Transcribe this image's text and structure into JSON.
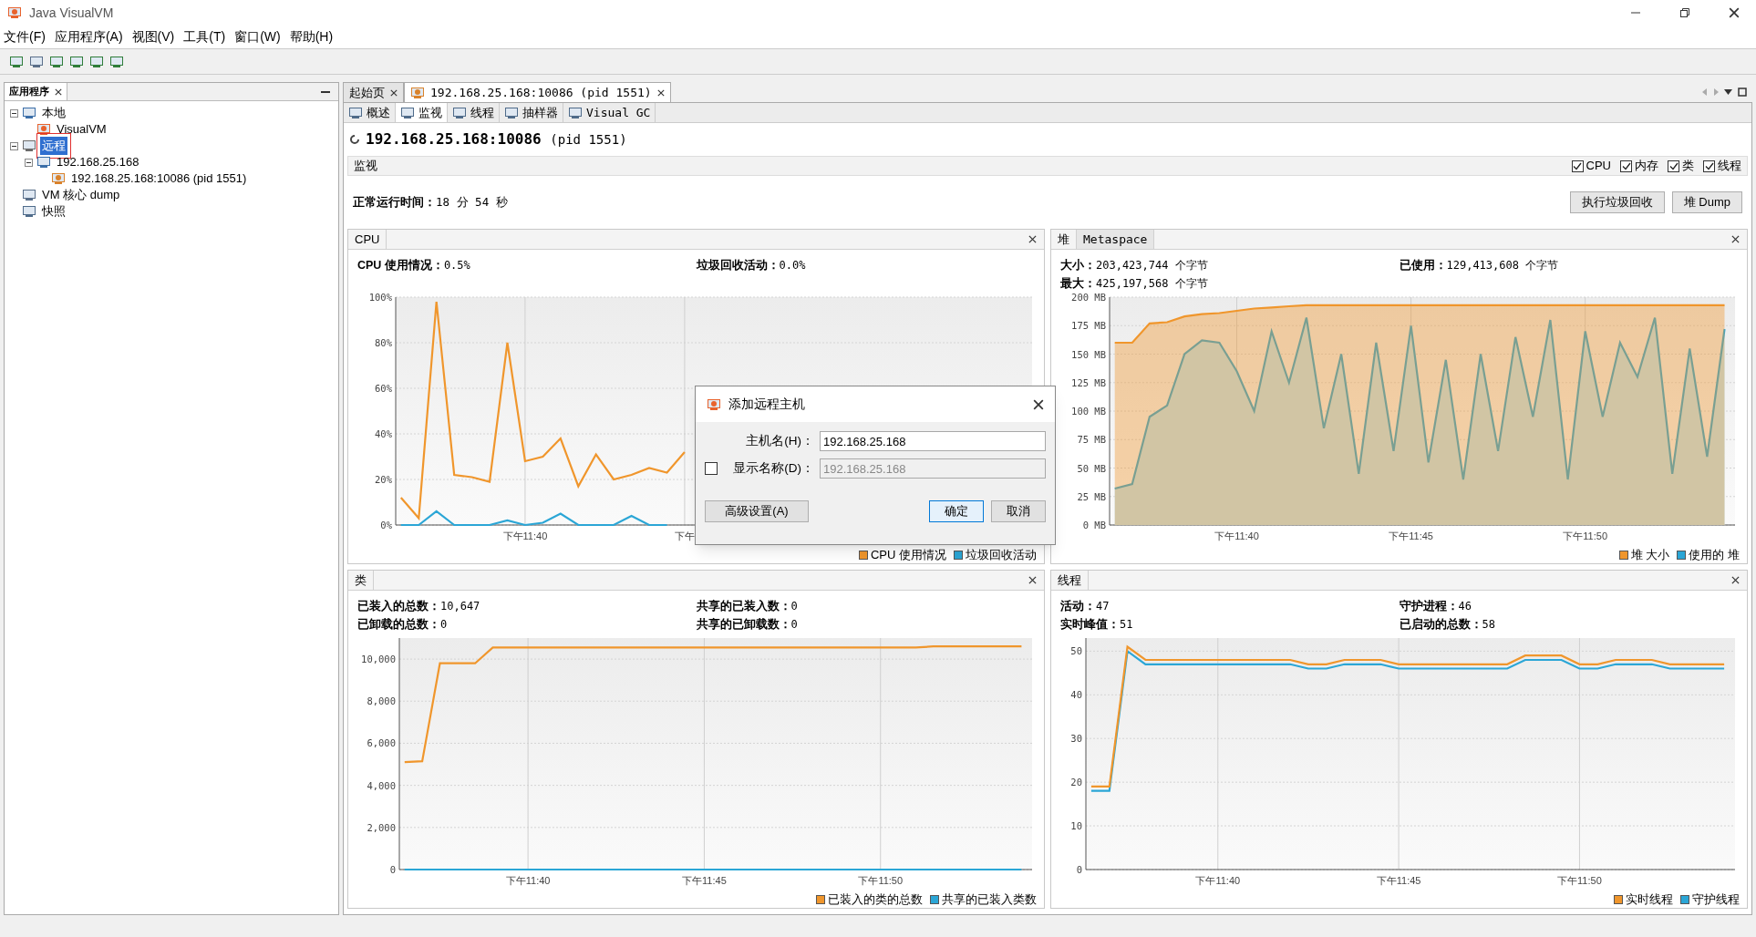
{
  "window": {
    "title": "Java VisualVM"
  },
  "menu": [
    "文件(F)",
    "应用程序(A)",
    "视图(V)",
    "工具(T)",
    "窗口(W)",
    "帮助(H)"
  ],
  "app_panel": {
    "tab": "应用程序",
    "tree": [
      {
        "label": "本地",
        "kind": "computer",
        "expanded": true,
        "selected": false,
        "children": [
          {
            "label": "VisualVM",
            "kind": "app",
            "selected": false
          }
        ]
      },
      {
        "label": "远程",
        "kind": "network",
        "expanded": true,
        "selected": true,
        "children": [
          {
            "label": "192.168.25.168",
            "kind": "host",
            "expanded": true,
            "selected": false,
            "children": [
              {
                "label": "192.168.25.168:10086 (pid 1551)",
                "kind": "jmx",
                "selected": false
              }
            ]
          }
        ]
      },
      {
        "label": "VM 核心 dump",
        "kind": "dump",
        "selected": false
      },
      {
        "label": "快照",
        "kind": "snapshot",
        "selected": false
      }
    ]
  },
  "doc_tabs": [
    {
      "label": "起始页",
      "selected": false
    },
    {
      "label": "192.168.25.168:10086 (pid 1551)",
      "selected": true
    }
  ],
  "sub_tabs": [
    {
      "label": "概述",
      "selected": false
    },
    {
      "label": "监视",
      "selected": true
    },
    {
      "label": "线程",
      "selected": false
    },
    {
      "label": "抽样器",
      "selected": false
    },
    {
      "label": "Visual GC",
      "selected": false
    }
  ],
  "page_title": {
    "host": "192.168.25.168:10086",
    "pid": "(pid 1551)"
  },
  "monitor_bar": {
    "label": "监视",
    "toggles": [
      {
        "label": "CPU",
        "checked": true
      },
      {
        "label": "内存",
        "checked": true
      },
      {
        "label": "类",
        "checked": true
      },
      {
        "label": "线程",
        "checked": true
      }
    ]
  },
  "uptime": {
    "label": "正常运行时间：",
    "value": "18 分 54 秒"
  },
  "buttons": [
    "执行垃圾回收",
    "堆 Dump"
  ],
  "panels": [
    {
      "kind": "cpu",
      "tabs": [
        {
          "label": "CPU",
          "selected": true
        }
      ],
      "stats": [
        {
          "label": "CPU 使用情况：",
          "value": "0.5%"
        },
        {
          "label": "垃圾回收活动：",
          "value": "0.0%"
        }
      ],
      "chart_data": {
        "type": "line",
        "categories": [
          null,
          null,
          null,
          null,
          null,
          null,
          null,
          "下午11:40",
          null,
          null,
          null,
          null,
          null,
          null,
          null,
          null,
          "下午",
          null,
          null,
          null,
          null,
          null,
          null,
          null,
          null,
          null,
          null,
          null,
          null,
          null,
          null,
          null,
          null,
          null,
          null,
          null
        ],
        "ylim": [
          0,
          100
        ],
        "yticks": [
          {
            "value": 0,
            "label": "0%"
          },
          {
            "value": 20,
            "label": "20%"
          },
          {
            "value": 40,
            "label": "40%"
          },
          {
            "value": 60,
            "label": "60%"
          },
          {
            "value": 80,
            "label": "80%"
          },
          {
            "value": 100,
            "label": "100%"
          }
        ],
        "series": [
          {
            "name": "CPU 使用情况",
            "color": "#f0962c",
            "values": [
              12,
              3,
              98,
              22,
              21,
              19,
              80,
              28,
              30,
              38,
              17,
              31,
              20,
              22,
              25,
              23,
              32,
              null,
              null,
              null,
              null,
              null,
              null,
              null,
              null,
              null,
              null,
              null,
              null,
              null,
              null,
              null,
              null,
              null,
              null,
              null
            ]
          },
          {
            "name": "垃圾回收活动",
            "color": "#2ba6d6",
            "values": [
              0,
              0,
              6,
              0,
              0,
              0,
              2,
              0,
              1,
              5,
              0,
              0,
              0,
              4,
              0,
              0,
              null,
              null,
              null,
              null,
              null,
              null,
              null,
              null,
              null,
              null,
              null,
              null,
              null,
              null,
              null,
              null,
              null,
              null,
              null,
              null
            ]
          }
        ],
        "grid": true,
        "legend": true
      }
    },
    {
      "kind": "heap",
      "tabs": [
        {
          "label": "堆",
          "selected": true
        },
        {
          "label": "Metaspace",
          "selected": false
        }
      ],
      "stats": [
        {
          "label": "大小：",
          "value": "203,423,744 个字节"
        },
        {
          "label": "已使用：",
          "value": "129,413,608 个字节"
        },
        {
          "label": "最大：",
          "value": "425,197,568 个字节"
        }
      ],
      "chart_data": {
        "type": "area",
        "categories": [
          null,
          null,
          null,
          null,
          null,
          null,
          null,
          "下午11:40",
          null,
          null,
          null,
          null,
          null,
          null,
          null,
          null,
          null,
          "下午11:45",
          null,
          null,
          null,
          null,
          null,
          null,
          null,
          null,
          null,
          "下午11:50",
          null,
          null,
          null,
          null,
          null,
          null,
          null,
          null
        ],
        "ylim": [
          0,
          200
        ],
        "yticks": [
          {
            "value": 0,
            "label": "0 MB"
          },
          {
            "value": 25,
            "label": "25 MB"
          },
          {
            "value": 50,
            "label": "50 MB"
          },
          {
            "value": 75,
            "label": "75 MB"
          },
          {
            "value": 100,
            "label": "100 MB"
          },
          {
            "value": 125,
            "label": "125 MB"
          },
          {
            "value": 150,
            "label": "150 MB"
          },
          {
            "value": 175,
            "label": "175 MB"
          },
          {
            "value": 200,
            "label": "200 MB"
          }
        ],
        "series": [
          {
            "name": "堆 大小",
            "color": "#f0962c",
            "values": [
              160,
              160,
              177,
              178,
              183,
              185,
              186,
              188,
              190,
              191,
              192,
              193,
              193,
              193,
              193,
              193,
              193,
              193,
              193,
              193,
              193,
              193,
              193,
              193,
              193,
              193,
              193,
              193,
              193,
              193,
              193,
              193,
              193,
              193,
              193,
              193
            ]
          },
          {
            "name": "使用的 堆",
            "color": "#2ba6d6",
            "values": [
              32,
              36,
              95,
              105,
              150,
              162,
              160,
              135,
              100,
              170,
              125,
              182,
              85,
              150,
              45,
              160,
              65,
              175,
              55,
              145,
              40,
              150,
              65,
              165,
              95,
              180,
              40,
              170,
              95,
              160,
              130,
              182,
              45,
              155,
              60,
              172
            ]
          }
        ],
        "grid": true,
        "legend": true
      }
    },
    {
      "kind": "classes",
      "tabs": [
        {
          "label": "类",
          "selected": true
        }
      ],
      "stats": [
        {
          "label": "已装入的总数：",
          "value": "10,647"
        },
        {
          "label": "共享的已装入数：",
          "value": "0"
        },
        {
          "label": "已卸载的总数：",
          "value": "0"
        },
        {
          "label": "共享的已卸载数：",
          "value": "0"
        }
      ],
      "chart_data": {
        "type": "line",
        "categories": [
          null,
          null,
          null,
          null,
          null,
          null,
          null,
          "下午11:40",
          null,
          null,
          null,
          null,
          null,
          null,
          null,
          null,
          null,
          "下午11:45",
          null,
          null,
          null,
          null,
          null,
          null,
          null,
          null,
          null,
          "下午11:50",
          null,
          null,
          null,
          null,
          null,
          null,
          null,
          null
        ],
        "ylim": [
          0,
          11000
        ],
        "yticks": [
          {
            "value": 0,
            "label": "0"
          },
          {
            "value": 2000,
            "label": "2,000"
          },
          {
            "value": 4000,
            "label": "4,000"
          },
          {
            "value": 6000,
            "label": "6,000"
          },
          {
            "value": 8000,
            "label": "8,000"
          },
          {
            "value": 10000,
            "label": "10,000"
          }
        ],
        "series": [
          {
            "name": "已装入的类的总数",
            "color": "#f0962c",
            "values": [
              5100,
              5150,
              9800,
              9800,
              9800,
              10550,
              10550,
              10550,
              10550,
              10550,
              10550,
              10550,
              10550,
              10550,
              10550,
              10550,
              10550,
              10550,
              10550,
              10550,
              10550,
              10550,
              10550,
              10550,
              10550,
              10550,
              10550,
              10550,
              10550,
              10550,
              10600,
              10600,
              10600,
              10600,
              10600,
              10600
            ]
          },
          {
            "name": "共享的已装入类数",
            "color": "#2ba6d6",
            "values": [
              0,
              0,
              0,
              0,
              0,
              0,
              0,
              0,
              0,
              0,
              0,
              0,
              0,
              0,
              0,
              0,
              0,
              0,
              0,
              0,
              0,
              0,
              0,
              0,
              0,
              0,
              0,
              0,
              0,
              0,
              0,
              0,
              0,
              0,
              0,
              0
            ]
          }
        ],
        "grid": true,
        "legend": true
      }
    },
    {
      "kind": "threads",
      "tabs": [
        {
          "label": "线程",
          "selected": true
        }
      ],
      "stats": [
        {
          "label": "活动：",
          "value": "47"
        },
        {
          "label": "守护进程：",
          "value": "46"
        },
        {
          "label": "实时峰值：",
          "value": "51"
        },
        {
          "label": "已启动的总数：",
          "value": "58"
        }
      ],
      "chart_data": {
        "type": "line",
        "categories": [
          null,
          null,
          null,
          null,
          null,
          null,
          null,
          "下午11:40",
          null,
          null,
          null,
          null,
          null,
          null,
          null,
          null,
          null,
          "下午11:45",
          null,
          null,
          null,
          null,
          null,
          null,
          null,
          null,
          null,
          "下午11:50",
          null,
          null,
          null,
          null,
          null,
          null,
          null,
          null
        ],
        "ylim": [
          0,
          53
        ],
        "yticks": [
          {
            "value": 0,
            "label": "0"
          },
          {
            "value": 10,
            "label": "10"
          },
          {
            "value": 20,
            "label": "20"
          },
          {
            "value": 30,
            "label": "30"
          },
          {
            "value": 40,
            "label": "40"
          },
          {
            "value": 50,
            "label": "50"
          }
        ],
        "series": [
          {
            "name": "实时线程",
            "color": "#f0962c",
            "values": [
              19,
              19,
              51,
              48,
              48,
              48,
              48,
              48,
              48,
              48,
              48,
              48,
              47,
              47,
              48,
              48,
              48,
              47,
              47,
              47,
              47,
              47,
              47,
              47,
              49,
              49,
              49,
              47,
              47,
              48,
              48,
              48,
              47,
              47,
              47,
              47
            ]
          },
          {
            "name": "守护线程",
            "color": "#2ba6d6",
            "values": [
              18,
              18,
              50,
              47,
              47,
              47,
              47,
              47,
              47,
              47,
              47,
              47,
              46,
              46,
              47,
              47,
              47,
              46,
              46,
              46,
              46,
              46,
              46,
              46,
              48,
              48,
              48,
              46,
              46,
              47,
              47,
              47,
              46,
              46,
              46,
              46
            ]
          }
        ],
        "grid": true,
        "legend": true
      }
    }
  ],
  "dialog": {
    "title": "添加远程主机",
    "fields": [
      {
        "kind": "text",
        "label": "主机名(H)：",
        "value": "192.168.25.168",
        "disabled": false
      },
      {
        "kind": "checkbox",
        "label": "显示名称(D)：",
        "checked": false,
        "value": "192.168.25.168",
        "disabled": true
      }
    ],
    "buttons": [
      {
        "label": "高级设置(A)",
        "default": false
      },
      {
        "label": "确定",
        "default": true
      },
      {
        "label": "取消",
        "default": false
      }
    ]
  }
}
